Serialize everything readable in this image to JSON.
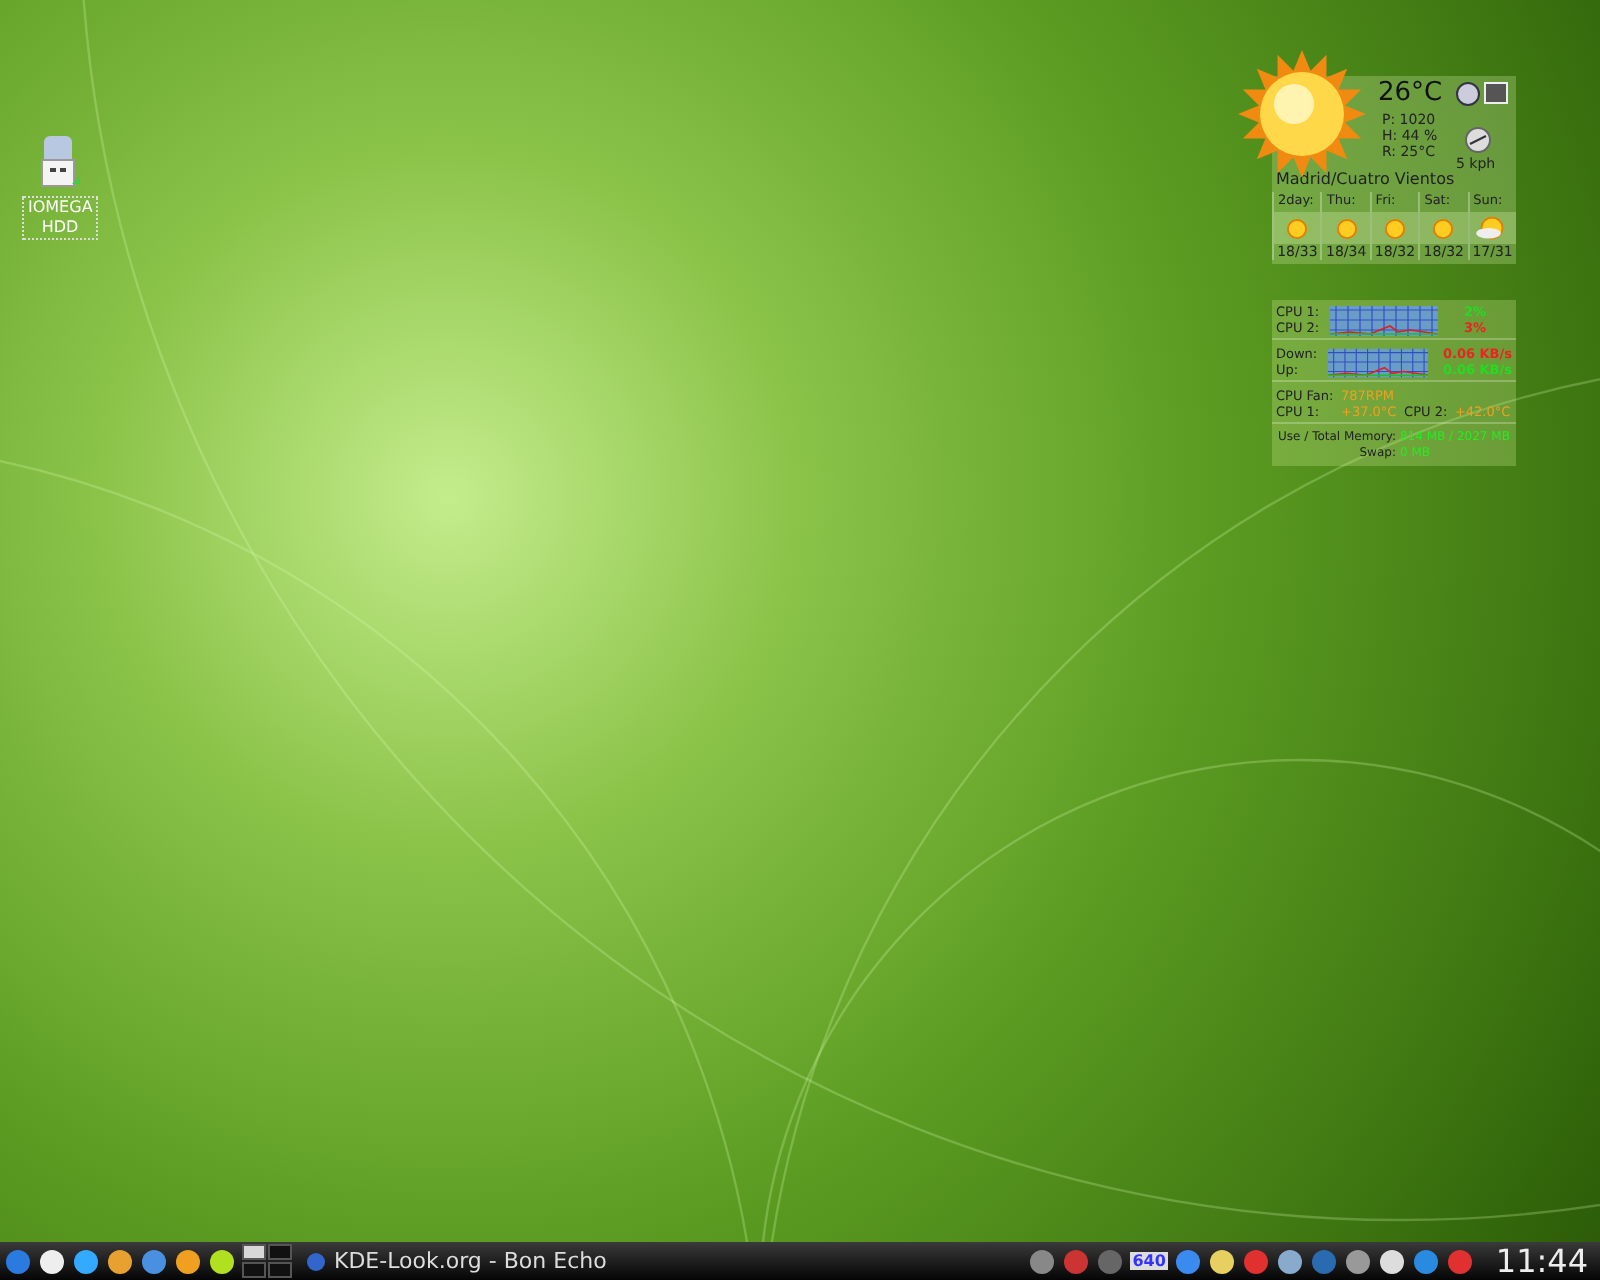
{
  "desktop_icons": [
    {
      "label": "IOMEGA HDD"
    }
  ],
  "weather": {
    "temperature": "26°C",
    "details": [
      "P: 1020",
      "H: 44 %",
      "R: 25°C"
    ],
    "wind": "5 kph",
    "location": "Madrid/Cuatro Vientos",
    "forecast": [
      {
        "day": "2day:",
        "kind": "sun",
        "temps": "18/33"
      },
      {
        "day": "Thu:",
        "kind": "sun",
        "temps": "18/34"
      },
      {
        "day": "Fri:",
        "kind": "sun",
        "temps": "18/32"
      },
      {
        "day": "Sat:",
        "kind": "sun",
        "temps": "18/32"
      },
      {
        "day": "Sun:",
        "kind": "cloudy",
        "temps": "17/31"
      }
    ]
  },
  "monitor": {
    "cpu": [
      {
        "label": "CPU 1:",
        "value": "2%",
        "color": "#22dd22"
      },
      {
        "label": "CPU 2:",
        "value": "3%",
        "color": "#ee2222"
      }
    ],
    "network": [
      {
        "label": "Down:",
        "value": "0.06 KB/s",
        "color": "#ee2222"
      },
      {
        "label": "Up:",
        "value": "0.06 KB/s",
        "color": "#22dd22"
      }
    ],
    "fan": {
      "label": "CPU Fan:",
      "value": "787RPM"
    },
    "temps": [
      {
        "label": "CPU 1:",
        "value": "+37.0°C"
      },
      {
        "label": "CPU 2:",
        "value": "+42.0°C"
      }
    ],
    "memory": [
      {
        "label": "Use / Total Memory:",
        "value": "814 MB / 2027 MB"
      },
      {
        "label": "Swap:",
        "value": "0 MB"
      }
    ]
  },
  "taskbar": {
    "pager": [
      {
        "selected": true
      },
      {
        "selected": false
      },
      {
        "selected": false
      },
      {
        "selected": false
      }
    ],
    "task": "KDE-Look.org - Bon Echo",
    "tray_badge": "640",
    "clock": "11:44"
  }
}
